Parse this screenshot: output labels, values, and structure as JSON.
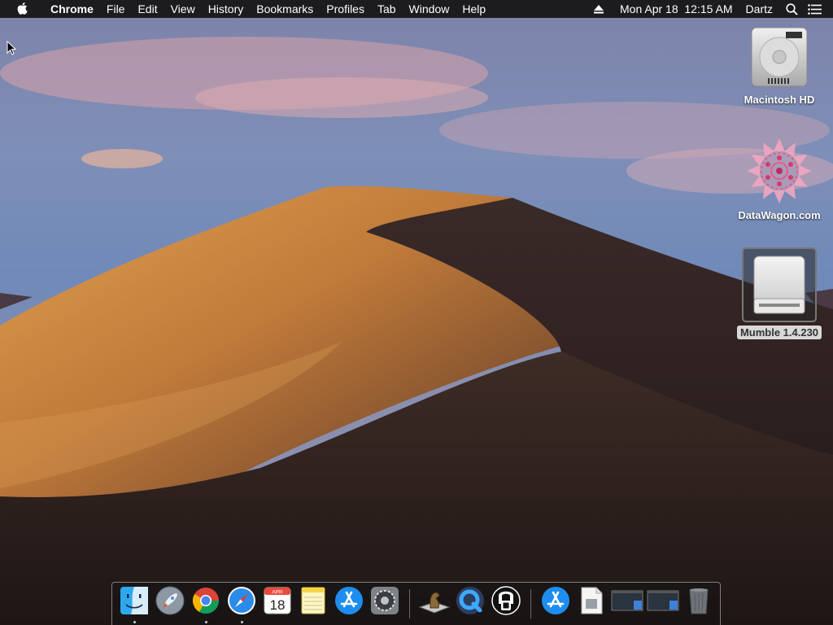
{
  "menubar": {
    "app_name": "Chrome",
    "menus": [
      "File",
      "Edit",
      "View",
      "History",
      "Bookmarks",
      "Profiles",
      "Tab",
      "Window",
      "Help"
    ],
    "clock": "Mon Apr 18  12:15 AM",
    "user": "Dartz"
  },
  "desktop_icons": {
    "hd_label": "Macintosh HD",
    "datawagon_label": "DataWagon.com",
    "mumble_label": "Mumble 1.4.230"
  },
  "dock": {
    "calendar_month": "APR",
    "calendar_day": "18",
    "app_names": [
      "Finder",
      "Launchpad",
      "Google Chrome",
      "Safari",
      "Calendar",
      "Notes",
      "App Store",
      "System Preferences",
      "Chess",
      "QuickTime Player",
      "Mumble",
      "App Store Downloads",
      "Preview",
      "Screenshot",
      "Screenshot",
      "Trash"
    ]
  },
  "colors": {
    "menubar_bg": "#1c1c1e",
    "selection_label_bg": "#d8d8d8"
  }
}
